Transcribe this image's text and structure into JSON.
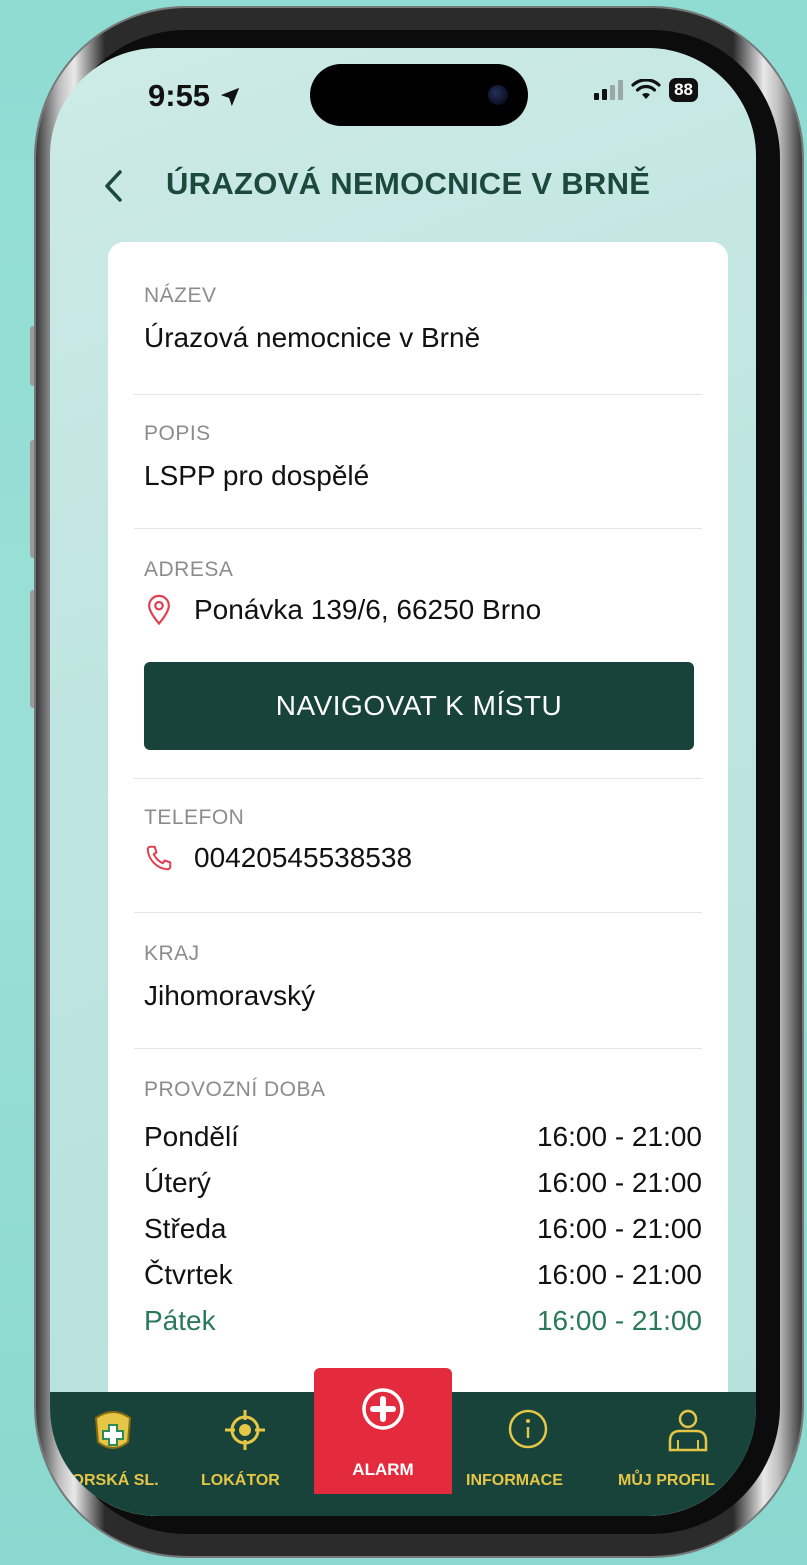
{
  "status_bar": {
    "time": "9:55",
    "battery": "88"
  },
  "header": {
    "title": "ÚRAZOVÁ NEMOCNICE V BRNĚ"
  },
  "card": {
    "name_label": "NÁZEV",
    "name_value": "Úrazová nemocnice v Brně",
    "desc_label": "POPIS",
    "desc_value": "LSPP pro dospělé",
    "address_label": "ADRESA",
    "address_value": "Ponávka 139/6, 66250 Brno",
    "navigate_button": "NAVIGOVAT K MÍSTU",
    "phone_label": "TELEFON",
    "phone_value": "00420545538538",
    "region_label": "KRAJ",
    "region_value": "Jihomoravský",
    "hours_label": "PROVOZNÍ DOBA",
    "hours": [
      {
        "day": "Pondělí",
        "time": "16:00 - 21:00"
      },
      {
        "day": "Úterý",
        "time": "16:00 - 21:00"
      },
      {
        "day": "Středa",
        "time": "16:00 - 21:00"
      },
      {
        "day": "Čtvrtek",
        "time": "16:00 - 21:00"
      },
      {
        "day": "Pátek",
        "time": "16:00 - 21:00"
      }
    ]
  },
  "tabs": {
    "horska": "HORSKÁ SL.",
    "lokator": "LOKÁTOR",
    "alarm": "ALARM",
    "informace": "INFORMACE",
    "profil": "MŮJ PROFIL"
  },
  "colors": {
    "accent_dark_green": "#17433a",
    "title_green": "#1b4a3c",
    "alarm_red": "#e32b3d",
    "tab_label_yellow": "#e5c646",
    "today_green": "#2a7a5a",
    "icon_red": "#e04050"
  }
}
